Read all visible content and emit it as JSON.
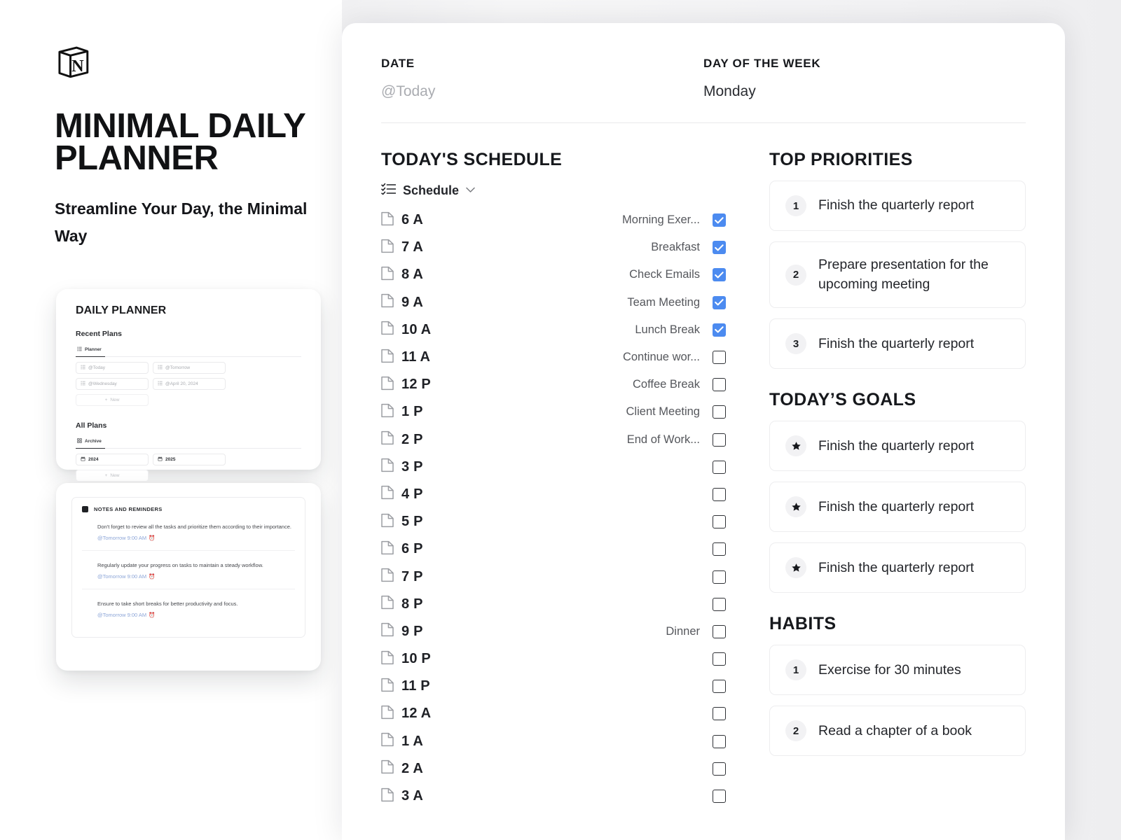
{
  "brand": {
    "logo_icon": "notion-cube-icon",
    "title": "MINIMAL DAILY PLANNER",
    "subtitle": "Streamline Your Day, the Minimal Way"
  },
  "preview_planner": {
    "title": "DAILY PLANNER",
    "recent_section": "Recent Plans",
    "recent_tab": "Planner",
    "recent_items": [
      {
        "label": "@Today",
        "icon": "list-icon"
      },
      {
        "label": "@Tomorrow",
        "icon": "list-icon"
      },
      {
        "label": "@Wednesday",
        "icon": "list-icon"
      },
      {
        "label": "@April 20, 2024",
        "icon": "list-icon"
      }
    ],
    "new_label": "New",
    "all_section": "All Plans",
    "all_tab": "Archive",
    "all_items": [
      {
        "label": "2024",
        "icon": "calendar-icon"
      },
      {
        "label": "2025",
        "icon": "calendar-icon"
      }
    ]
  },
  "preview_notes": {
    "header": "NOTES AND REMINDERS",
    "items": [
      {
        "text": "Don't forget to review all the tasks and prioritize them according to their importance.",
        "when": "@Tomorrow 9:00 AM"
      },
      {
        "text": "Regularly update your progress on tasks to maintain a steady workflow.",
        "when": "@Tomorrow 9:00 AM"
      },
      {
        "text": "Ensure to take short breaks for better productivity and focus.",
        "when": "@Tomorrow 9:00 AM"
      }
    ]
  },
  "planner": {
    "date_label": "DATE",
    "date_value": "@Today",
    "day_label": "DAY OF THE WEEK",
    "day_value": "Monday",
    "schedule_title": "TODAY'S SCHEDULE",
    "schedule_db_label": "Schedule",
    "schedule_db_icon": "checklist-icon",
    "schedule": [
      {
        "time": "6 A",
        "task": "Morning Exer...",
        "done": true
      },
      {
        "time": "7 A",
        "task": "Breakfast",
        "done": true
      },
      {
        "time": "8 A",
        "task": "Check Emails",
        "done": true
      },
      {
        "time": "9 A",
        "task": "Team Meeting",
        "done": true
      },
      {
        "time": "10 A",
        "task": "Lunch Break",
        "done": true
      },
      {
        "time": "11 A",
        "task": "Continue wor...",
        "done": false
      },
      {
        "time": "12 P",
        "task": "Coffee Break",
        "done": false
      },
      {
        "time": "1 P",
        "task": "Client Meeting",
        "done": false
      },
      {
        "time": "2 P",
        "task": "End of Work...",
        "done": false
      },
      {
        "time": "3 P",
        "task": "",
        "done": false
      },
      {
        "time": "4 P",
        "task": "",
        "done": false
      },
      {
        "time": "5 P",
        "task": "",
        "done": false
      },
      {
        "time": "6 P",
        "task": "",
        "done": false
      },
      {
        "time": "7 P",
        "task": "",
        "done": false
      },
      {
        "time": "8 P",
        "task": "",
        "done": false
      },
      {
        "time": "9 P",
        "task": "Dinner",
        "done": false
      },
      {
        "time": "10 P",
        "task": "",
        "done": false
      },
      {
        "time": "11 P",
        "task": "",
        "done": false
      },
      {
        "time": "12 A",
        "task": "",
        "done": false
      },
      {
        "time": "1 A",
        "task": "",
        "done": false
      },
      {
        "time": "2 A",
        "task": "",
        "done": false
      },
      {
        "time": "3 A",
        "task": "",
        "done": false
      }
    ],
    "priorities_title": "TOP PRIORITIES",
    "priorities": [
      {
        "badge": "1",
        "text": "Finish the quarterly report"
      },
      {
        "badge": "2",
        "text": "Prepare presentation for the upcoming meeting"
      },
      {
        "badge": "3",
        "text": "Finish the quarterly report"
      }
    ],
    "goals_title": "TODAY’S GOALS",
    "goals": [
      {
        "icon": "star-icon",
        "text": "Finish the quarterly report"
      },
      {
        "icon": "star-icon",
        "text": "Finish the quarterly report"
      },
      {
        "icon": "star-icon",
        "text": "Finish the quarterly report"
      }
    ],
    "habits_title": "HABITS",
    "habits": [
      {
        "badge": "1",
        "text": "Exercise for 30 minutes"
      },
      {
        "badge": "2",
        "text": "Read a chapter of a book"
      }
    ]
  },
  "colors": {
    "checkbox_checked": "#4c8bf0",
    "text_primary": "#16181c",
    "text_muted": "#aaacb1",
    "panel_bg": "#f3f3f5"
  }
}
